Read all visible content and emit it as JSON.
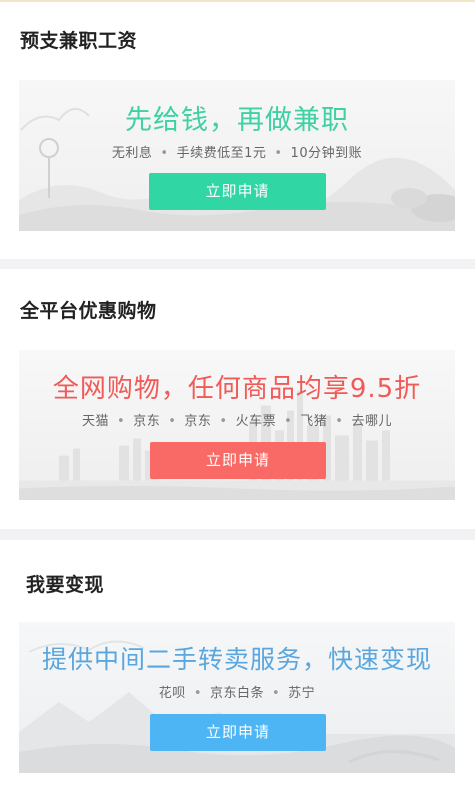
{
  "sections": [
    {
      "title": "预支兼职工资",
      "headline": "先给钱，再做兼职",
      "features": [
        "无利息",
        "手续费低至1元",
        "10分钟到账"
      ],
      "button_label": "立即申请",
      "accent_color": "#31d6a5"
    },
    {
      "title": "全平台优惠购物",
      "headline": "全网购物，任何商品均享9.5折",
      "features": [
        "天猫",
        "京东",
        "京东",
        "火车票",
        "飞猪",
        "去哪儿"
      ],
      "button_label": "立即申请",
      "accent_color": "#f96a66"
    },
    {
      "title": "我要变现",
      "headline": "提供中间二手转卖服务，快速变现",
      "features": [
        "花呗",
        "京东白条",
        "苏宁"
      ],
      "button_label": "立即申请",
      "accent_color": "#4db5f3"
    }
  ],
  "separator_glyph": "•"
}
